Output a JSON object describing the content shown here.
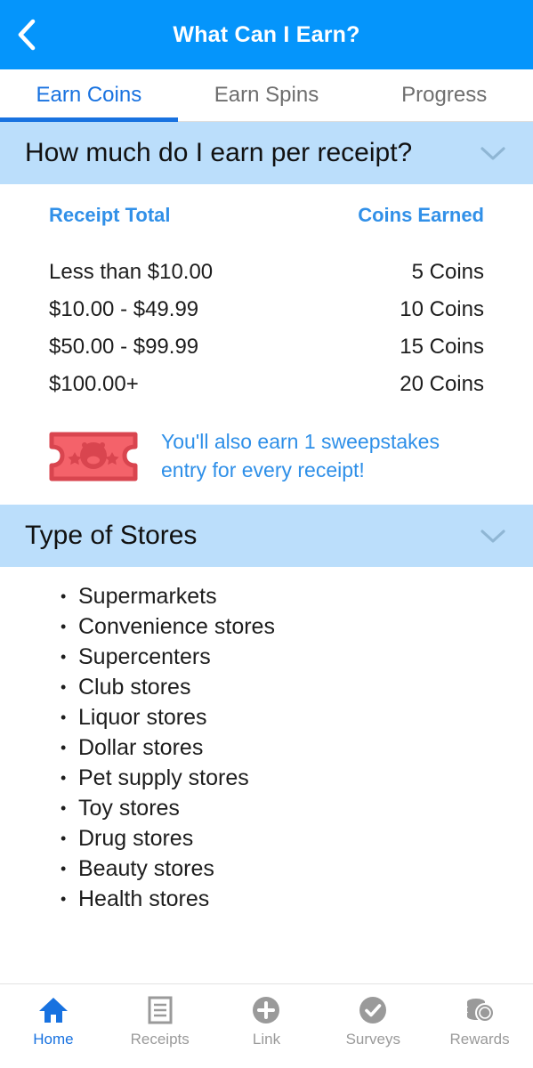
{
  "colors": {
    "appbar_blue": "#0595fb",
    "accent_blue": "#1872e0",
    "link_blue": "#2e8fe8",
    "panel_blue": "#bbdefb",
    "ticket_red": "#f4626a",
    "ticket_red_dark": "#d9454f",
    "inactive_gray": "#9a9a9a"
  },
  "appbar": {
    "back_icon": "chevron-left-icon",
    "title": "What Can I Earn?"
  },
  "tabs": [
    {
      "label": "Earn Coins",
      "active": true
    },
    {
      "label": "Earn Spins",
      "active": false
    },
    {
      "label": "Progress",
      "active": false
    }
  ],
  "sections": [
    {
      "title": "How much do I earn per receipt?",
      "chevron_icon": "chevron-down-icon",
      "expanded": true
    },
    {
      "title": "Type of Stores",
      "chevron_icon": "chevron-down-icon",
      "expanded": true
    }
  ],
  "earnings_table": {
    "headers": [
      "Receipt Total",
      "Coins Earned"
    ],
    "rows": [
      {
        "range": "Less than $10.00",
        "coins": "5 Coins"
      },
      {
        "range": "$10.00 - $49.99",
        "coins": "10 Coins"
      },
      {
        "range": "$50.00 - $99.99",
        "coins": "15 Coins"
      },
      {
        "range": "$100.00+",
        "coins": "20 Coins"
      }
    ]
  },
  "sweepstakes": {
    "icon": "ticket-icon",
    "text": "You'll also earn 1 sweepstakes entry for every receipt!"
  },
  "store_types": [
    "Supermarkets",
    "Convenience stores",
    "Supercenters",
    "Club stores",
    "Liquor stores",
    "Dollar stores",
    "Pet supply stores",
    "Toy stores",
    "Drug stores",
    "Beauty stores",
    "Health stores"
  ],
  "bottom_nav": [
    {
      "label": "Home",
      "icon": "home-icon",
      "active": true
    },
    {
      "label": "Receipts",
      "icon": "receipt-icon",
      "active": false
    },
    {
      "label": "Link",
      "icon": "plus-circle-icon",
      "active": false
    },
    {
      "label": "Surveys",
      "icon": "check-circle-icon",
      "active": false
    },
    {
      "label": "Rewards",
      "icon": "coins-icon",
      "active": false
    }
  ]
}
